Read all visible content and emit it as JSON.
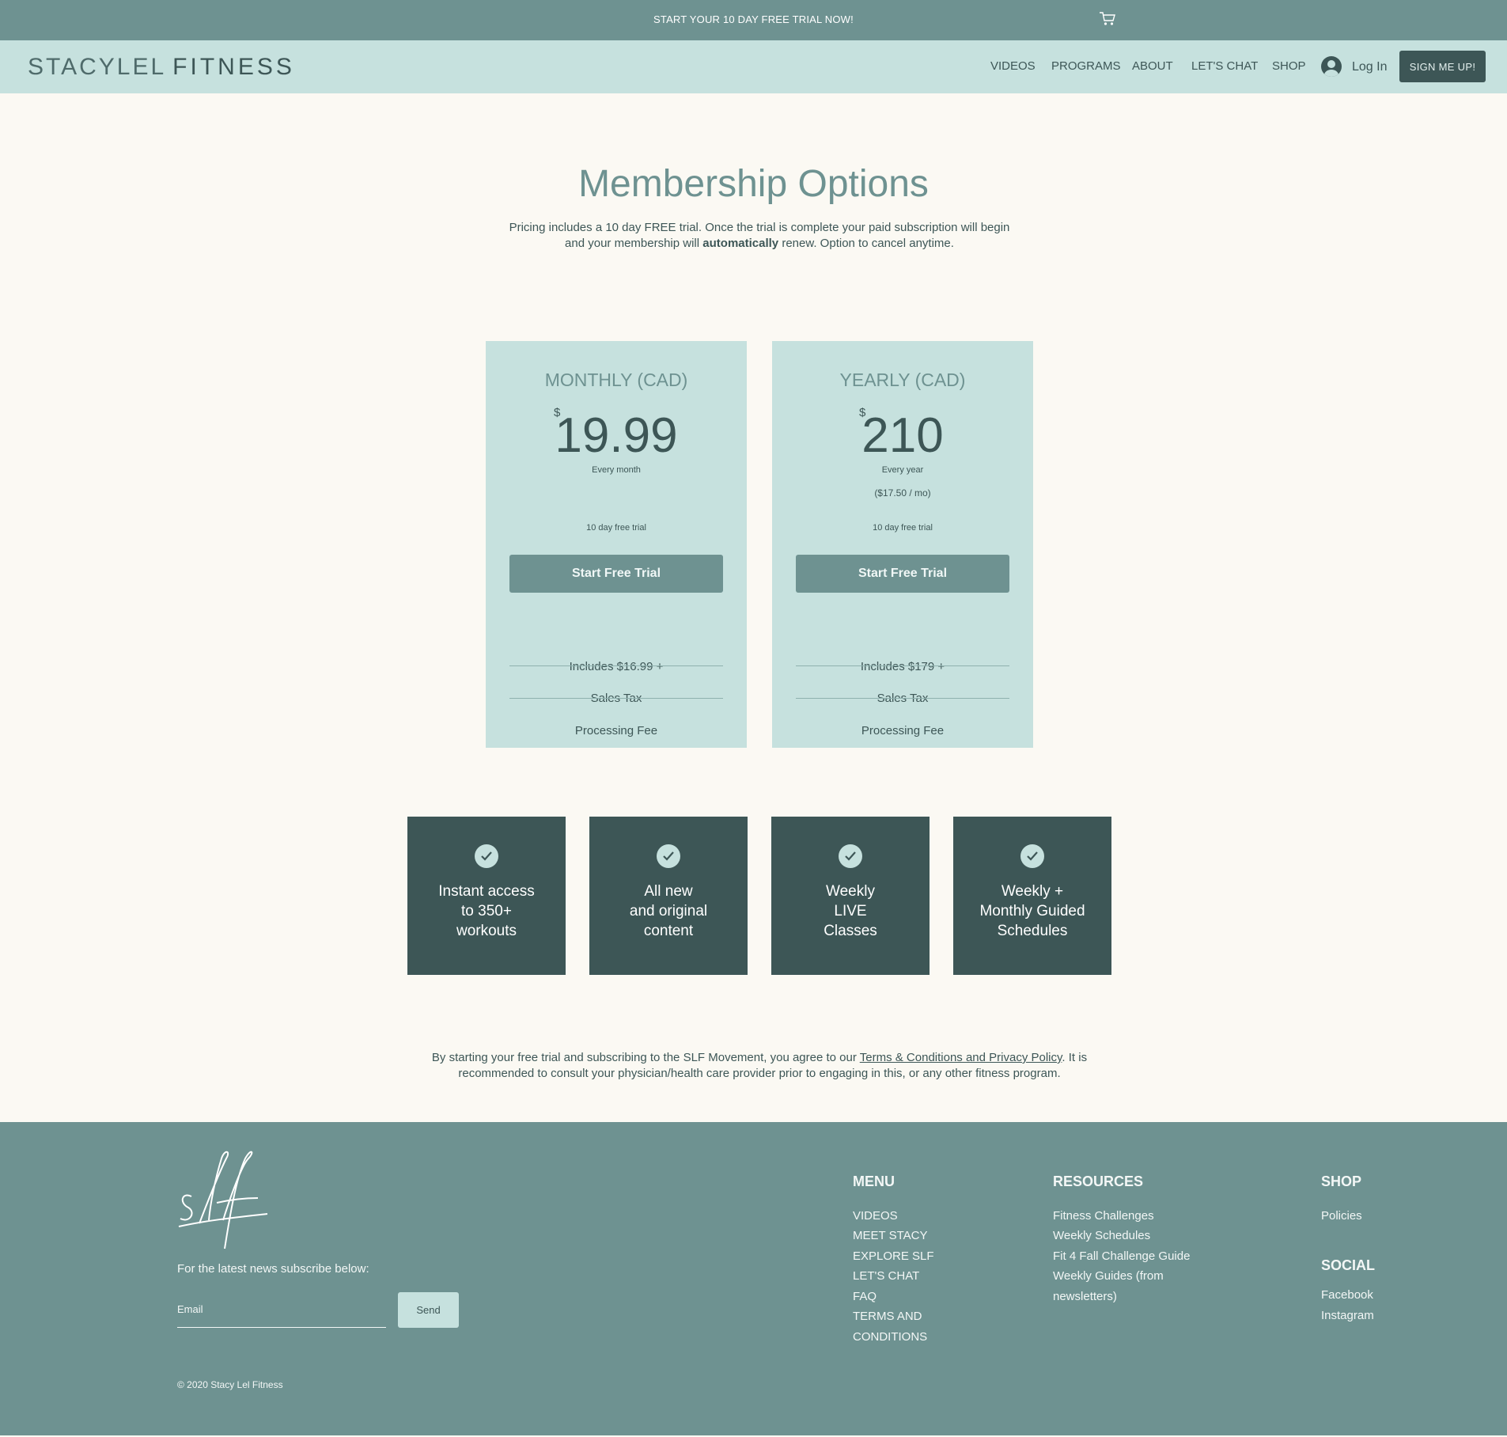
{
  "announcement": {
    "text": "START YOUR 10 DAY FREE TRIAL NOW!",
    "cart_icon": "cart-icon"
  },
  "header": {
    "logo_light": "STACYLEL",
    "logo_bold": "FITNESS",
    "nav": [
      "VIDEOS",
      "PROGRAMS",
      "ABOUT",
      "LET'S CHAT",
      "SHOP"
    ],
    "login": "Log In",
    "signup": "SIGN ME UP!"
  },
  "hero": {
    "title": "Membership Options",
    "intro_before": "Pricing includes a 10 day FREE trial. Once the trial is complete your paid subscription will begin and your membership will ",
    "intro_bold": "automatically",
    "intro_after": " renew. Option to cancel anytime."
  },
  "plans": [
    {
      "name": "MONTHLY (CAD)",
      "currency": "$",
      "price": "19.99",
      "period": "Every month",
      "per_month": "",
      "trial": "10 day free trial",
      "button": "Start Free Trial",
      "features": [
        "Includes $16.99 +",
        "Sales Tax",
        "Processing Fee"
      ]
    },
    {
      "name": "YEARLY (CAD)",
      "currency": "$",
      "price": "210",
      "period": "Every year",
      "per_month": "($17.50 / mo)",
      "trial": "10 day free trial",
      "button": "Start Free Trial",
      "features": [
        "Includes $179 +",
        "Sales Tax",
        "Processing Fee"
      ]
    }
  ],
  "benefits": [
    {
      "text": "Instant access to 350+ workouts",
      "lines": [
        "Instant access",
        "to 350+",
        "workouts"
      ],
      "icon": "check-icon"
    },
    {
      "text": "All new and original content",
      "lines": [
        "All new",
        "and original",
        "content"
      ],
      "icon": "check-icon"
    },
    {
      "text": "Weekly LIVE Classes",
      "lines": [
        "Weekly",
        "LIVE",
        "Classes"
      ],
      "icon": "check-icon"
    },
    {
      "text": "Weekly + Monthly Guided Schedules",
      "lines": [
        "Weekly +",
        "Monthly Guided",
        "Schedules"
      ],
      "icon": "check-icon"
    }
  ],
  "legal": {
    "before": "By starting your free trial and subscribing to the SLF Movement, you agree to our ",
    "link": "Terms & Conditions and Privacy Policy",
    "after": ". It is recommended to consult your physician/health care provider prior to engaging in this, or any other fitness program."
  },
  "footer": {
    "logo_icon": "slf-signature-logo",
    "subscribe_label": "For the latest news subscribe below:",
    "email_placeholder": "Email",
    "send": "Send",
    "copyright": "© 2020 Stacy Lel Fitness",
    "menu": {
      "title": "MENU",
      "items": [
        "VIDEOS",
        "MEET STACY",
        "EXPLORE SLF",
        "LET'S CHAT",
        "FAQ",
        "TERMS AND",
        "CONDITIONS"
      ]
    },
    "resources": {
      "title": "RESOURCES",
      "items": [
        "Fitness Challenges",
        "Weekly Schedules",
        "Fit 4 Fall Challenge Guide",
        "Weekly Guides (from",
        "newsletters)"
      ]
    },
    "shop": {
      "title": "SHOP",
      "items": [
        "Policies"
      ]
    },
    "social": {
      "title": "SOCIAL",
      "items": [
        "Facebook",
        "Instagram"
      ]
    }
  },
  "colors": {
    "top_bar": "#6e9291",
    "nav_bg": "#c6e1de",
    "page_bg": "#fbf9f3",
    "dark": "#3d5656",
    "footer_bg": "#6e9291"
  }
}
